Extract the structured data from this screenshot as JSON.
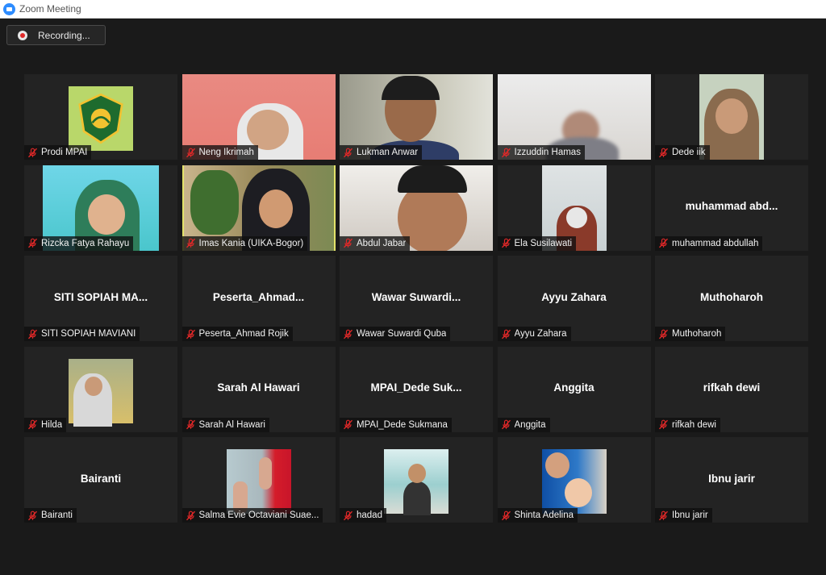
{
  "window": {
    "title": "Zoom Meeting"
  },
  "recording": {
    "label": "Recording..."
  },
  "participants": [
    {
      "name": "Prodi MPAI",
      "display": "",
      "video": "logo"
    },
    {
      "name": "Neng Ikrimah",
      "display": "",
      "video": "pink"
    },
    {
      "name": "Lukman Anwar",
      "display": "",
      "video": "room"
    },
    {
      "name": "Izzuddin Hamas",
      "display": "",
      "video": "blur"
    },
    {
      "name": "Dede iik",
      "display": "",
      "video": "portrait"
    },
    {
      "name": "Rizcka Fatya Rahayu",
      "display": "",
      "video": "sky"
    },
    {
      "name": "Imas Kania (UIKA-Bogor)",
      "display": "",
      "video": "plant"
    },
    {
      "name": "Abdul Jabar",
      "display": "",
      "video": "ceil"
    },
    {
      "name": "Ela Susilawati",
      "display": "",
      "video": "wall"
    },
    {
      "name": "muhammad abdullah",
      "display": "muhammad  abd...",
      "video": "none"
    },
    {
      "name": "SITI SOPIAH MAVIANI",
      "display": "SITI  SOPIAH  MA...",
      "video": "none"
    },
    {
      "name": "Peserta_Ahmad Rojik",
      "display": "Peserta_Ahmad...",
      "video": "none"
    },
    {
      "name": "Wawar Suwardi Quba",
      "display": "Wawar  Suwardi...",
      "video": "none"
    },
    {
      "name": "Ayyu Zahara",
      "display": "Ayyu Zahara",
      "video": "none"
    },
    {
      "name": "Muthoharoh",
      "display": "Muthoharoh",
      "video": "none"
    },
    {
      "name": "Hilda",
      "display": "",
      "video": "grass"
    },
    {
      "name": "Sarah Al Hawari",
      "display": "Sarah Al Hawari",
      "video": "none"
    },
    {
      "name": "MPAI_Dede Sukmana",
      "display": "MPAI_Dede  Suk...",
      "video": "none"
    },
    {
      "name": "Anggita",
      "display": "Anggita",
      "video": "none"
    },
    {
      "name": "rifkah dewi",
      "display": "rifkah dewi",
      "video": "none"
    },
    {
      "name": "Bairanti",
      "display": "Bairanti",
      "video": "none"
    },
    {
      "name": "Salma Evie Octaviani Suae...",
      "display": "",
      "video": "red"
    },
    {
      "name": "hadad",
      "display": "",
      "video": "lake"
    },
    {
      "name": "Shinta Adelina",
      "display": "",
      "video": "kids"
    },
    {
      "name": "Ibnu jarir",
      "display": "Ibnu jarir",
      "video": "none"
    }
  ],
  "active_speaker": "Imas Kania (UIKA-Bogor)",
  "colors": {
    "active_border": "#e3e36a",
    "muted_mic": "#e02828",
    "logo_ring": "#f2c230"
  }
}
